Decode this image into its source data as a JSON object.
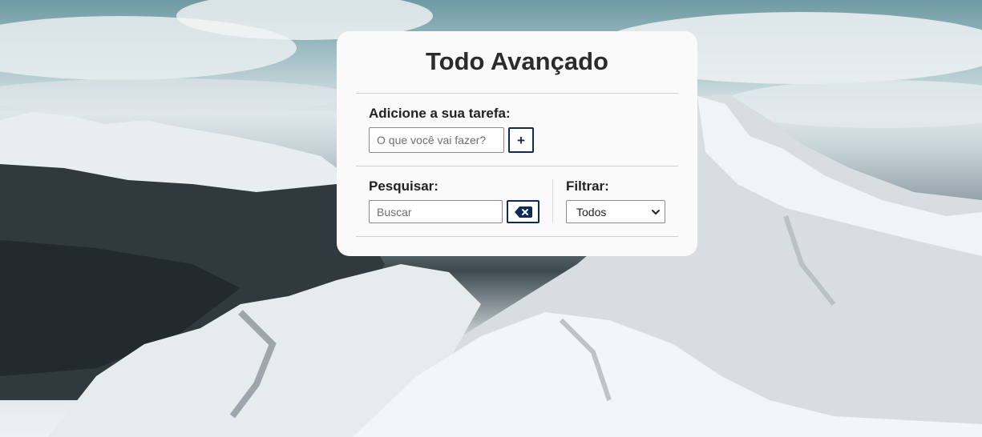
{
  "app": {
    "title": "Todo Avançado"
  },
  "add_section": {
    "label": "Adicione a sua tarefa:",
    "input_placeholder": "O que você vai fazer?",
    "input_value": "",
    "add_button_label": "+"
  },
  "search_section": {
    "label": "Pesquisar:",
    "input_placeholder": "Buscar",
    "input_value": "",
    "clear_button_icon": "backspace-icon"
  },
  "filter_section": {
    "label": "Filtrar:",
    "selected": "Todos"
  },
  "colors": {
    "accent": "#102a56",
    "card_bg": "#fafafa",
    "text": "#2b2b2b"
  }
}
